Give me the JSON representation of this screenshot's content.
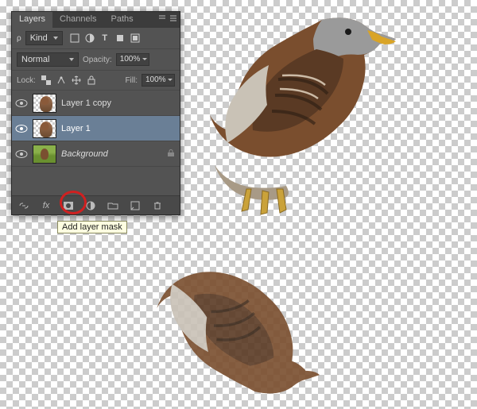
{
  "panel": {
    "tabs": [
      {
        "label": "Layers",
        "active": true
      },
      {
        "label": "Channels",
        "active": false
      },
      {
        "label": "Paths",
        "active": false
      }
    ],
    "kind_filter_label": "Kind",
    "blend_mode": "Normal",
    "opacity_label": "Opacity:",
    "opacity_value": "100%",
    "lock_label": "Lock:",
    "fill_label": "Fill:",
    "fill_value": "100%",
    "layers": [
      {
        "name": "Layer 1 copy",
        "selected": false,
        "thumb": "checker-bird",
        "italic": false
      },
      {
        "name": "Layer 1",
        "selected": true,
        "thumb": "checker-bird",
        "italic": false
      },
      {
        "name": "Background",
        "selected": false,
        "thumb": "bg",
        "italic": true,
        "locked": true
      }
    ],
    "bottom_icons": [
      "link-icon",
      "fx-icon",
      "mask-icon",
      "adjustment-icon",
      "group-icon",
      "new-layer-icon",
      "trash-icon"
    ]
  },
  "tooltip": "Add layer mask"
}
